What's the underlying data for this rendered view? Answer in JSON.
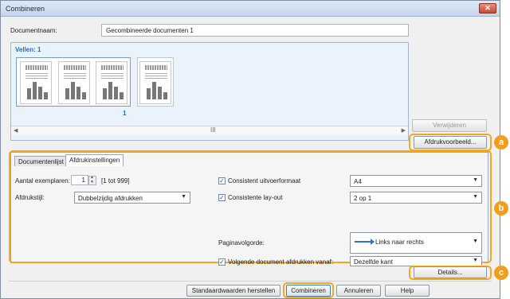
{
  "window": {
    "title": "Combineren",
    "close_glyph": "✕"
  },
  "document_name": {
    "label": "Documentnaam:",
    "value": "Gecombineerde documenten 1"
  },
  "sheets": {
    "label": "Vellen: 1",
    "sheet_number": "1",
    "scroll_grip": "III"
  },
  "buttons": {
    "remove": "Verwijderen",
    "print_preview": "Afdrukvoorbeeld...",
    "details": "Details...",
    "restore_defaults": "Standaardwaarden herstellen",
    "combine": "Combineren",
    "cancel": "Annuleren",
    "help": "Help"
  },
  "tabs": [
    {
      "label": "Documentenlijst",
      "active": false
    },
    {
      "label": "Afdrukinstellingen",
      "active": true
    }
  ],
  "settings": {
    "copies_label": "Aantal exemplaren:",
    "copies_value": "1",
    "copies_range": "[1 tot 999]",
    "print_style_label": "Afdrukstijl:",
    "print_style_value": "Dubbelzijdig afdrukken",
    "consistent_size_label": "Consistent uitvoerformaat",
    "consistent_size_value": "A4",
    "consistent_layout_label": "Consistente lay-out",
    "consistent_layout_value": "2 op 1",
    "page_order_label": "Paginavolgorde:",
    "page_order_value": "Links naar rechts",
    "next_doc_label": "Volgende document afdrukken vanaf:",
    "next_doc_value": "Dezelfde kant"
  },
  "callouts": {
    "a": "a",
    "b": "b",
    "c": "c"
  },
  "colors": {
    "callout": "#f29d1d",
    "accent": "#1f6fb8"
  }
}
